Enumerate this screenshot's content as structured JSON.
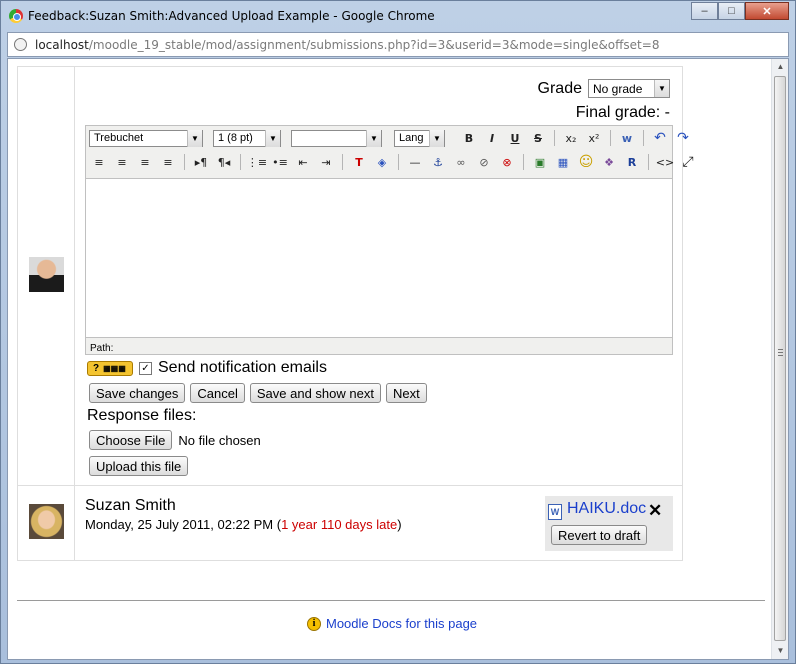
{
  "window": {
    "title": "Feedback:Suzan Smith:Advanced Upload Example - Google Chrome",
    "controls": {
      "minimize": "–",
      "maximize": "□",
      "close": "✕"
    }
  },
  "address": {
    "host": "localhost",
    "path": "/moodle_19_stable/mod/assignment/submissions.php?id=3&userid=3&mode=single&offset=8"
  },
  "grade": {
    "label": "Grade",
    "selected": "No grade",
    "final_label": "Final grade: -"
  },
  "editor": {
    "font_family": "Trebuchet",
    "font_size": "1 (8 pt)",
    "format": "",
    "lang": "Lang",
    "toolbar1": {
      "bold": "B",
      "italic": "I",
      "underline": "U",
      "strike": "S",
      "subscript": "x₂",
      "superscript": "x²",
      "clean": "w",
      "undo": "↶",
      "redo": "↷"
    },
    "toolbar2": {
      "align_left": "≡",
      "align_center": "≡",
      "align_right": "≡",
      "justify": "≡",
      "ltr": "▸¶",
      "rtl": "¶◂",
      "ordered_list": "⋮≡",
      "unordered_list": "•≡",
      "outdent": "⇤",
      "indent": "⇥",
      "text_color": "T",
      "bg_color": "◈",
      "hr": "—",
      "anchor": "⚓",
      "link": "∞",
      "unlink": "⊘",
      "nolink": "⊗",
      "image": "▣",
      "table": "▦",
      "smiley": "☺",
      "char": "❖",
      "search": "R",
      "html": "<>",
      "fullscreen": "⤢"
    },
    "path_label": "Path:"
  },
  "notify": {
    "help_label": "?",
    "checked": "✓",
    "label": "Send notification emails"
  },
  "buttons": {
    "save": "Save changes",
    "cancel": "Cancel",
    "save_next": "Save and show next",
    "next": "Next"
  },
  "response_files": {
    "label": "Response files:",
    "choose": "Choose File",
    "no_file": "No file chosen",
    "upload": "Upload this file"
  },
  "submission": {
    "name": "Suzan Smith",
    "date": "Monday, 25 July 2011, 02:22 PM (",
    "late": "1 year 110 days late",
    "date_end": ")",
    "file": "HAIKU.doc",
    "delete": "✕",
    "revert": "Revert to draft"
  },
  "footer": {
    "info": "i",
    "link": "Moodle Docs for this page"
  },
  "scrollbar": {
    "up": "▲",
    "down": "▼"
  }
}
